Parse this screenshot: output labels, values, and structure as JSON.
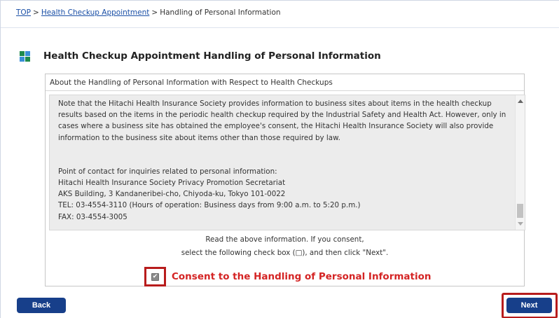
{
  "breadcrumb": {
    "items": [
      "TOP",
      "Health Checkup Appointment",
      "Handling of Personal Information"
    ],
    "separator": ">"
  },
  "page": {
    "title": "Health Checkup Appointment Handling of Personal Information"
  },
  "panel": {
    "header": "About the Handling of Personal Information with Respect to Health Checkups",
    "paragraphs": [
      "Note that the Hitachi Health Insurance Society provides information to business sites about items in the health checkup results based on the items in the periodic health checkup required by the Industrial Safety and Health Act. However, only in cases where a business site has obtained the employee's consent, the Hitachi Health Insurance Society will also provide information to the business site about items other than those required by law."
    ],
    "contact_lines": [
      "Point of contact for inquiries related to personal information:",
      "Hitachi Health Insurance Society Privacy Promotion Secretariat",
      "AKS Building, 3 Kandaneribei-cho, Chiyoda-ku, Tokyo 101-0022",
      "TEL: 03-4554-3110 (Hours of operation: Business days from 9:00 a.m. to 5:20 p.m.)",
      "FAX: 03-4554-3005"
    ],
    "instruction_line1": "Read the above information. If you consent,",
    "instruction_line2": "select the following check box (□), and then click \"Next\".",
    "consent_label": "Consent to the Handling of Personal Information",
    "consent_checked": true
  },
  "buttons": {
    "back": "Back",
    "next": "Next"
  },
  "colors": {
    "link": "#1a4fa6",
    "button_bg": "#173f8a",
    "highlight_border": "#b81c1c",
    "consent_text": "#d42424"
  },
  "icons": {
    "title": "grid-squares-icon",
    "checkbox": "check-icon"
  }
}
